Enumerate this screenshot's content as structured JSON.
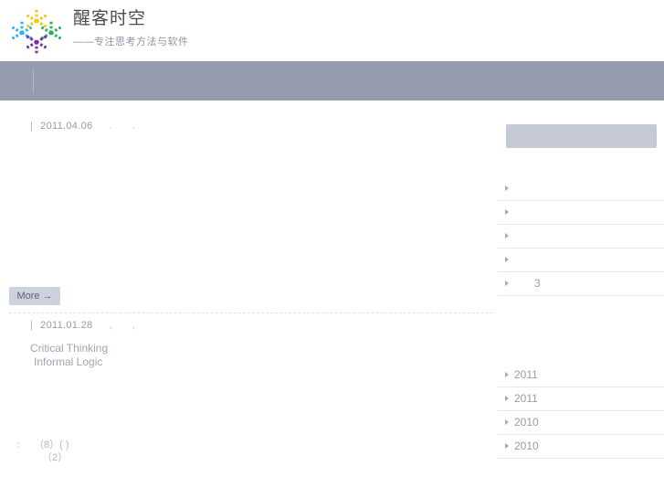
{
  "site": {
    "title": "醒客时空",
    "tagline": "——专注思考方法与软件",
    "logo_icon": "dotted-asterisk-logo"
  },
  "nav": {
    "divider_icon": "vertical-divider",
    "items": []
  },
  "posts": [
    {
      "meta_bar": "|",
      "date": "2011.04.06",
      "extra_1": ".",
      "extra_2": ".",
      "title": "",
      "body": ""
    },
    {
      "meta_bar": "|",
      "date": "2011.01.28",
      "extra_1": ",",
      "extra_2": ",",
      "title": "",
      "terms": [
        "Critical Thinking",
        "Informal Logic"
      ]
    }
  ],
  "more_button": {
    "label": "More →",
    "arrow_icon": "arrow-right-icon"
  },
  "footnote": {
    "separator": ":",
    "line_1": "（8）( )",
    "line_2": "（2）"
  },
  "sidebar": {
    "search": {
      "value": "",
      "placeholder": ""
    },
    "links_widget": {
      "title": "",
      "items": [
        {
          "label": "",
          "count": ""
        },
        {
          "label": "",
          "count": ""
        },
        {
          "label": "",
          "count": ""
        },
        {
          "label": "",
          "count": ""
        },
        {
          "label": "",
          "count": "3"
        }
      ]
    },
    "archive_widget": {
      "title": "",
      "items": [
        {
          "label": "2011",
          "count": ""
        },
        {
          "label": "2011",
          "count": ""
        },
        {
          "label": "2010",
          "count": ""
        },
        {
          "label": "2010",
          "count": ""
        }
      ]
    }
  },
  "colors": {
    "nav_bg": "#959cad",
    "button_bg": "#ced2de",
    "search_bg": "#c6cad7",
    "text": "#9a9aa6",
    "logo_yellow": "#f5c518",
    "logo_cyan": "#2fb4e9",
    "logo_green": "#2fae5e",
    "logo_purple": "#7b2fa5"
  }
}
